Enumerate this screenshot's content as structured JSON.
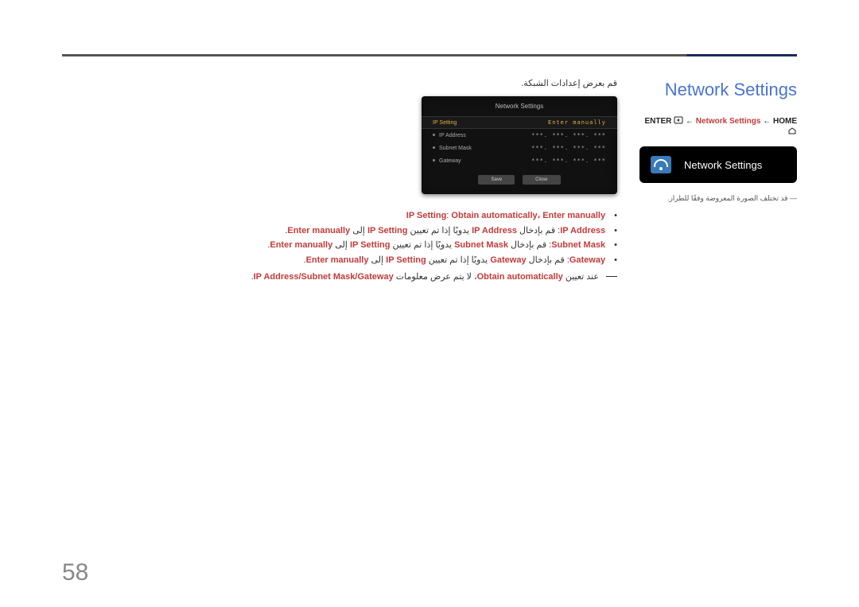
{
  "page_number": "58",
  "section_title": "Network Settings",
  "breadcrumb": {
    "enter": "ENTER",
    "middle": "Network Settings",
    "home": "HOME"
  },
  "ui_card_label": "Network Settings",
  "disclaimer_prefix": "―",
  "disclaimer": "قد تختلف الصورة المعروضة وفقًا للطراز.",
  "intro": "قم بعرض إعدادات الشبكة.",
  "dialog": {
    "title": "Network Settings",
    "header_label": "IP Setting",
    "header_value": "Enter manually",
    "rows": [
      {
        "label": "IP Address",
        "value": "***. ***. ***. ***"
      },
      {
        "label": "Subnet Mask",
        "value": "***. ***. ***. ***"
      },
      {
        "label": "Gateway",
        "value": "***. ***. ***. ***"
      }
    ],
    "btn_save": "Save",
    "btn_close": "Close"
  },
  "bullets": {
    "b1_pre": "IP Setting",
    "b1_mid": ": ",
    "b1_red": "Obtain automatically، Enter manually",
    "b2_pre": "IP Address",
    "b2_mid1": ": قم بإدخال ",
    "b2_red1": "IP Address",
    "b2_mid2": " يدويًا إذا تم تعيين ",
    "b2_red2": "IP Setting",
    "b2_mid3": " إلى ",
    "b2_red3": "Enter manually",
    "b2_end": ".",
    "b3_pre": "Subnet Mask",
    "b3_mid1": ": قم بإدخال ",
    "b3_red1": "Subnet Mask",
    "b3_mid2": " يدويًا إذا تم تعيين ",
    "b3_red2": "IP Setting",
    "b3_mid3": " إلى ",
    "b3_red3": "Enter manually",
    "b3_end": ".",
    "b4_pre": "Gateway",
    "b4_mid1": ": قم بإدخال ",
    "b4_red1": "Gateway",
    "b4_mid2": " يدويًا إذا تم تعيين ",
    "b4_red2": "IP Setting",
    "b4_mid3": " إلى ",
    "b4_red3": "Enter manually",
    "b4_end": "."
  },
  "note": {
    "pre": "عند تعيين ",
    "red1": "Obtain automatically",
    "mid": "، لا يتم عرض معلومات ",
    "red2": "IP Address/Subnet Mask/Gateway",
    "end": "."
  }
}
